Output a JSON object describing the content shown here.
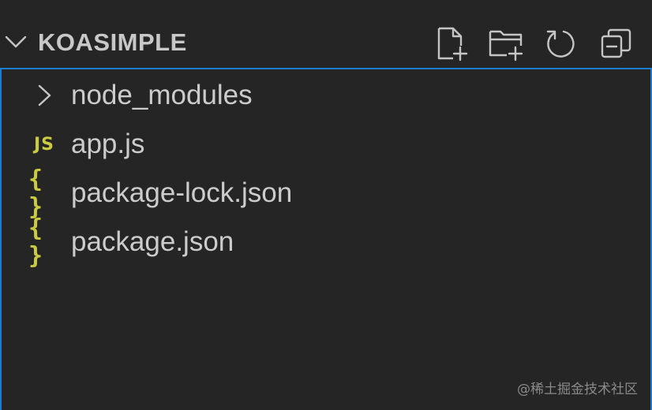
{
  "explorer": {
    "title": "KOASIMPLE",
    "actions": [
      {
        "name": "new-file",
        "icon": "new-file-icon"
      },
      {
        "name": "new-folder",
        "icon": "new-folder-icon"
      },
      {
        "name": "refresh",
        "icon": "refresh-icon"
      },
      {
        "name": "collapse-all",
        "icon": "collapse-all-icon"
      }
    ],
    "items": [
      {
        "label": "node_modules",
        "type": "folder",
        "icon": "chevron-right-icon"
      },
      {
        "label": "app.js",
        "type": "js",
        "icon_text": "JS"
      },
      {
        "label": "package-lock.json",
        "type": "json",
        "icon_text": "{ }"
      },
      {
        "label": "package.json",
        "type": "json",
        "icon_text": "{ }"
      }
    ]
  },
  "watermark": "@稀土掘金技术社区",
  "colors": {
    "background": "#252526",
    "focus_border": "#1d7bd0",
    "icon_yellow": "#cbcb41",
    "text": "#cccccc"
  }
}
